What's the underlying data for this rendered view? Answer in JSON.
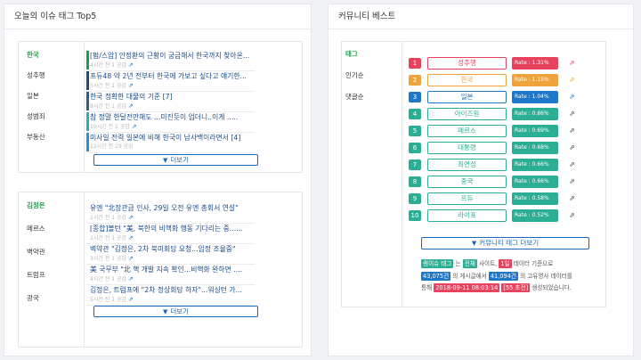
{
  "left_panel": {
    "title": "오늘의 이슈 태그 Top5",
    "group1": {
      "tags": [
        "한국",
        "성추행",
        "일본",
        "성범죄",
        "부동산"
      ],
      "news": [
        {
          "title": "[펌/스압] 안정환의 근황이 궁금해서 한국까지 찾아온...",
          "meta": "4시간 전 1 공감",
          "color": "#1e9c4a"
        },
        {
          "title": "프듀48 약 2년 전부터 한국에 가보고 싶다고 얘기한...",
          "meta": "5시간 전 1 공감",
          "color": "#1b4f7a"
        },
        {
          "title": "한국 정확한 대물의 기준 [7]",
          "meta": "8시간 전 1 공감",
          "color": "#2c5f8a"
        },
        {
          "title": "참 정말 한달전만해도 ...미진듯이 업더니..이게 .....",
          "meta": "10시간 전 1 공감",
          "color": "#27b0b8"
        },
        {
          "title": "미사일 전력 일본에 비해 한국이 남사백이라면서 [4]",
          "meta": "12시간 전 29 공감",
          "color": "#2e8fd0"
        }
      ],
      "more_label": "더보기"
    },
    "group2": {
      "tags": [
        "김정은",
        "메르스",
        "벽약관",
        "트럼프",
        "광국"
      ],
      "news": [
        {
          "title": "유엔 \"北장관급 인사, 29일 오전 유엔 총회서 연설\"",
          "meta": "1시간 전 1 공감"
        },
        {
          "title": "[종합]볼턴 \"美, 북한의 비핵화 행동 기다리는 중......",
          "meta": "2시간 전 1 공감"
        },
        {
          "title": "벽약관 \"김정은, 2차 북미회담 요청...임정 조율중\"",
          "meta": "3시간 전 1 공감"
        },
        {
          "title": "美 국무부 \"北 핵 개발 지속 확인...비핵화 완하면 ....",
          "meta": "4시간 전 1 공감"
        },
        {
          "title": "김정은, 트럼프에 \"2차 정상회담 하자\"...워싱턴 가...",
          "meta": "5시간 전 1 공감"
        }
      ],
      "more_label": "더보기"
    }
  },
  "right_panel": {
    "title": "커뮤니티 베스트",
    "tabs": [
      "태그",
      "인기순",
      "댓글순"
    ],
    "rankings": [
      {
        "rank": "1",
        "name": "성추행",
        "rate": "Rate : 1.31%",
        "num_color": "#e8425e",
        "name_color": "#e8425e",
        "rate_color": "#e8425e",
        "ext_color": "#e8425e"
      },
      {
        "rank": "2",
        "name": "한국",
        "rate": "Rate : 1.15%",
        "num_color": "#f0a33a",
        "name_color": "#f0a33a",
        "rate_color": "#f0a33a",
        "ext_color": "#f0a33a"
      },
      {
        "rank": "3",
        "name": "일본",
        "rate": "Rate : 1.04%",
        "num_color": "#1f77c9",
        "name_color": "#1f77c9",
        "rate_color": "#1f77c9",
        "ext_color": "#1f77c9"
      },
      {
        "rank": "4",
        "name": "아이즈원",
        "rate": "Rate : 0.86%",
        "num_color": "#2aaf94",
        "name_color": "#2aaf94",
        "rate_color": "#2aaf94",
        "ext_color": "#444444"
      },
      {
        "rank": "5",
        "name": "메르스",
        "rate": "Rate : 0.69%",
        "num_color": "#2aaf94",
        "name_color": "#2aaf94",
        "rate_color": "#2aaf94",
        "ext_color": "#444444"
      },
      {
        "rank": "6",
        "name": "대통령",
        "rate": "Rate : 0.68%",
        "num_color": "#2aaf94",
        "name_color": "#2aaf94",
        "rate_color": "#2aaf94",
        "ext_color": "#444444"
      },
      {
        "rank": "7",
        "name": "최연성",
        "rate": "Rate : 0.66%",
        "num_color": "#2aaf94",
        "name_color": "#2aaf94",
        "rate_color": "#2aaf94",
        "ext_color": "#444444"
      },
      {
        "rank": "8",
        "name": "중국",
        "rate": "Rate : 0.66%",
        "num_color": "#2aaf94",
        "name_color": "#2aaf94",
        "rate_color": "#2aaf94",
        "ext_color": "#444444"
      },
      {
        "rank": "9",
        "name": "프듀",
        "rate": "Rate : 0.58%",
        "num_color": "#2aaf94",
        "name_color": "#2aaf94",
        "rate_color": "#2aaf94",
        "ext_color": "#444444"
      },
      {
        "rank": "10",
        "name": "라이프",
        "rate": "Rate : 0.52%",
        "num_color": "#2aaf94",
        "name_color": "#2aaf94",
        "rate_color": "#2aaf94",
        "ext_color": "#444444"
      }
    ],
    "more_label": "커뮤니티 태그 더보기",
    "info": {
      "hl1": "랭이슈 태그",
      "t1": " 는 ",
      "hl2": "전체",
      "t2": " 사이트, ",
      "hl3": "1일",
      "t3": " 데이터 기준으로",
      "hl4": "43,075건",
      "t4": " 의 게시글에서 ",
      "hl5": "41,094건",
      "t5": " 의 고유명사 데이터를",
      "t6": "통해 ",
      "hl6": "2018-09-11 08:03:14",
      "t7": " ",
      "hl7": "[55 초전]",
      "t8": " 생성되었습니다."
    }
  }
}
